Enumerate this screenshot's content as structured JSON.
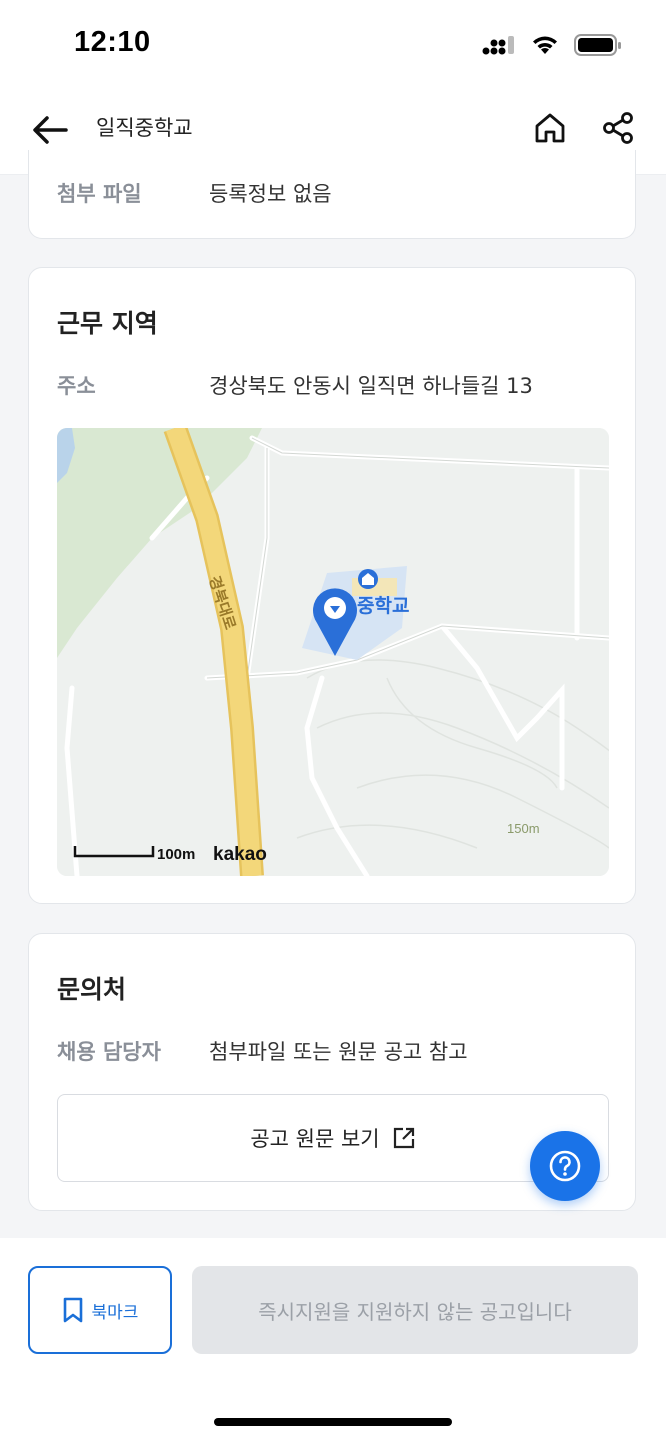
{
  "status_bar": {
    "time": "12:10"
  },
  "header": {
    "title": "일직중학교"
  },
  "attachment": {
    "label": "첨부 파일",
    "value": "등록정보 없음"
  },
  "work_region": {
    "title": "근무 지역",
    "address_label": "주소",
    "address_value": "경상북도 안동시 일직면 하나들길 13",
    "map": {
      "road_label": "경북대로",
      "poi_label": "중학교",
      "scale_label": "100m",
      "provider": "kakao",
      "contour_label": "150m"
    }
  },
  "contact": {
    "title": "문의처",
    "manager_label": "채용 담당자",
    "manager_value": "첨부파일 또는 원문 공고 참고",
    "original_button": "공고 원문 보기"
  },
  "bottom": {
    "bookmark_label": "북마크",
    "apply_label": "즉시지원을 지원하지 않는 공고입니다"
  },
  "colors": {
    "accent": "#1a73e8",
    "road": "#f3d77a"
  }
}
